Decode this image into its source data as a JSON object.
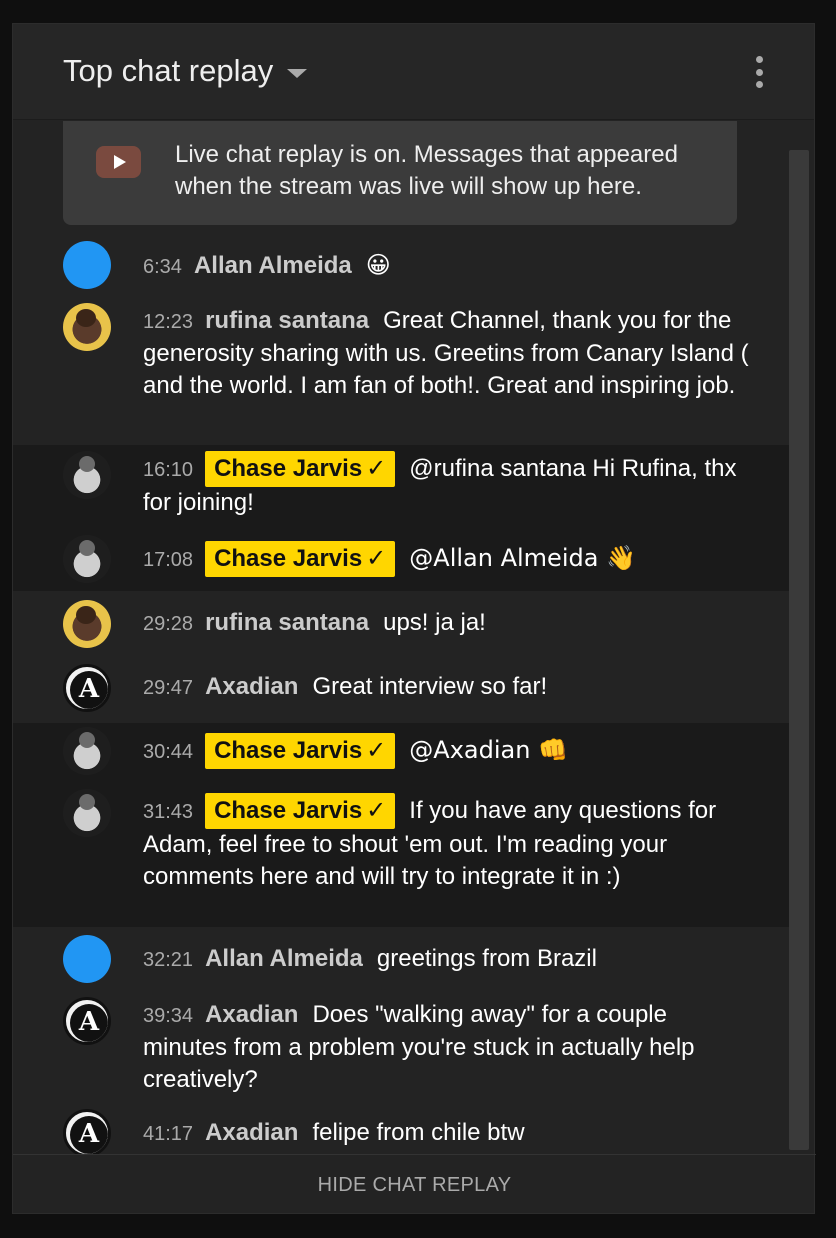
{
  "header": {
    "title": "Top chat replay",
    "menu_icon": "more-vert-icon"
  },
  "banner": {
    "icon": "youtube-icon",
    "text": "Live chat replay is on. Messages that appeared when the stream was live will show up here."
  },
  "messages": [
    {
      "time": "6:34",
      "author": "Allan Almeida",
      "owner": false,
      "text": "😀",
      "avatar": "blue-circle"
    },
    {
      "time": "12:23",
      "author": "rufina santana",
      "owner": false,
      "text": "Great Channel, thank you for the generosity sharing with us. Greetins from Canary Island ( and the world. I am fan of both!. Great and inspiring job.",
      "avatar": "photo"
    },
    {
      "time": "16:10",
      "author": "Chase Jarvis",
      "owner": true,
      "text": "@rufina santana Hi Rufina, thx for joining!",
      "avatar": "photo"
    },
    {
      "time": "17:08",
      "author": "Chase Jarvis",
      "owner": true,
      "text": "@Allan Almeida 👋",
      "avatar": "photo"
    },
    {
      "time": "29:28",
      "author": "rufina santana",
      "owner": false,
      "text": "ups! ja ja!",
      "avatar": "photo"
    },
    {
      "time": "29:47",
      "author": "Axadian",
      "owner": false,
      "text": "Great interview so far!",
      "avatar": "ax-logo"
    },
    {
      "time": "30:44",
      "author": "Chase Jarvis",
      "owner": true,
      "text": "@Axadian 👊",
      "avatar": "photo"
    },
    {
      "time": "31:43",
      "author": "Chase Jarvis",
      "owner": true,
      "text": "If you have any questions for Adam, feel free to shout 'em out. I'm reading your comments here and will try to integrate it in :)",
      "avatar": "photo"
    },
    {
      "time": "32:21",
      "author": "Allan Almeida",
      "owner": false,
      "text": "greetings from Brazil",
      "avatar": "blue-circle"
    },
    {
      "time": "39:34",
      "author": "Axadian",
      "owner": false,
      "text": "Does \"walking away\" for a couple minutes from a problem you're stuck in actually help creatively?",
      "avatar": "ax-logo"
    },
    {
      "time": "41:17",
      "author": "Axadian",
      "owner": false,
      "text": "felipe from chile btw",
      "avatar": "ax-logo"
    }
  ],
  "owner_check": "✓",
  "ax_glyph": "A",
  "footer": {
    "label": "HIDE CHAT REPLAY"
  }
}
